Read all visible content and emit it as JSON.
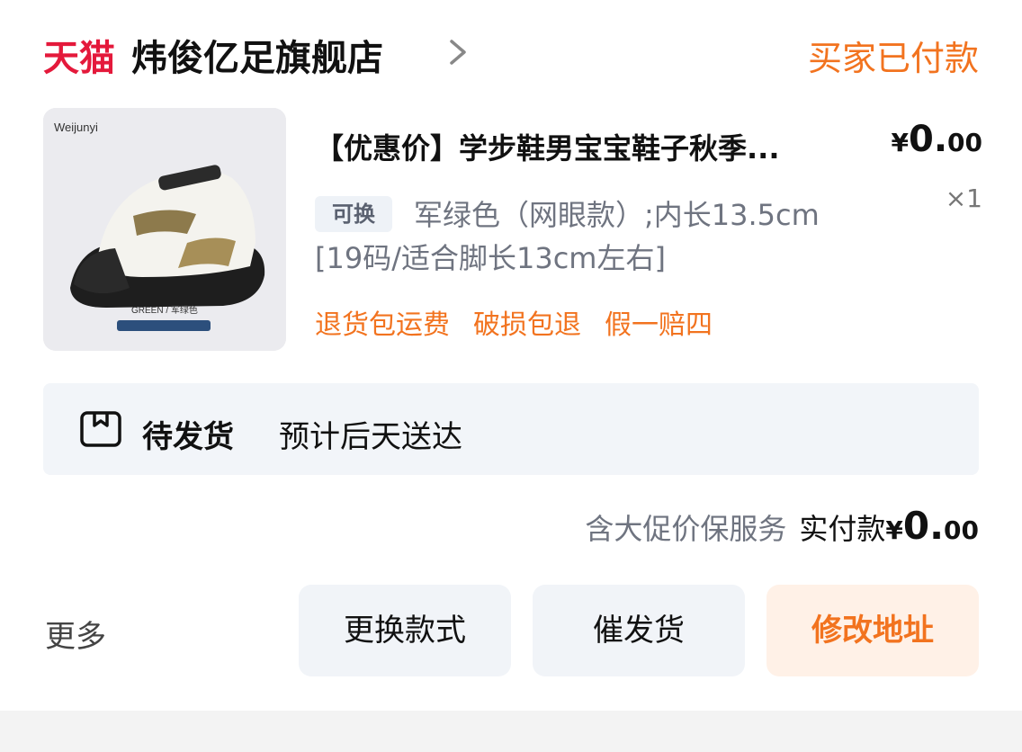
{
  "header": {
    "platform": "天猫",
    "shop_name": "炜俊亿足旗舰店",
    "order_status": "买家已付款",
    "brand_color": "#e4193b",
    "accent_color": "#f2731f"
  },
  "product": {
    "image_brand": "Weijunyi",
    "image_color_label": "GREEN / 军绿色",
    "title": "【优惠价】学步鞋男宝宝鞋子秋季...",
    "price_symbol": "¥",
    "price_int": "0.",
    "price_dec": "00",
    "quantity": "×1",
    "exchange_tag": "可换",
    "spec_line1": "军绿色（网眼款）;内长13.5cm",
    "spec_line2": "[19码/适合脚长13cm左右]",
    "services": [
      "退货包运费",
      "破损包退",
      "假一赔四"
    ]
  },
  "shipping": {
    "icon": "package-box-icon",
    "status": "待发货",
    "eta": "预计后天送达"
  },
  "summary": {
    "service_note": "含大促价保服务",
    "paid_label": "实付款",
    "price_symbol": "¥",
    "price_int": "0.",
    "price_dec": "00"
  },
  "actions": {
    "more": "更多",
    "change_style": "更换款式",
    "urge_ship": "催发货",
    "modify_address": "修改地址"
  }
}
